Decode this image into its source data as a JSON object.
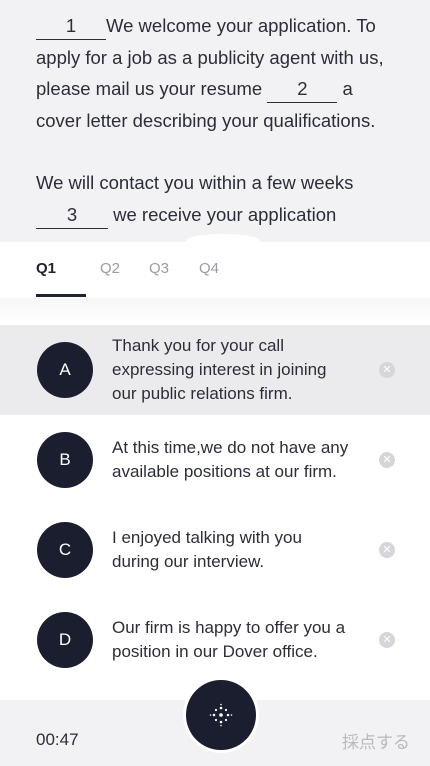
{
  "passage": {
    "blank1": "1",
    "line1_rest": "We welcome your application. To apply for a job as a publicity agent with us, please mail us your resume",
    "blank2": "2",
    "line2_rest": "a cover letter describing your qualifications.",
    "line3_start": "We will contact you within a few weeks",
    "blank3": "3",
    "line3_rest": "we receive your application"
  },
  "tabs": [
    {
      "label": "Q1",
      "active": true
    },
    {
      "label": "Q2",
      "active": false
    },
    {
      "label": "Q3",
      "active": false
    },
    {
      "label": "Q4",
      "active": false
    }
  ],
  "options": [
    {
      "letter": "A",
      "text": "Thank you for your call expressing interest in joining our public relations firm.",
      "selected": true
    },
    {
      "letter": "B",
      "text": "At this time,we do not have any available positions at our firm.",
      "selected": false
    },
    {
      "letter": "C",
      "text": "I enjoyed talking with you during our interview.",
      "selected": false
    },
    {
      "letter": "D",
      "text": "Our firm is happy to offer you a position in our Dover office.",
      "selected": false
    }
  ],
  "footer": {
    "timer": "00:47",
    "score_label": "採点する",
    "center_icon": "sparkle-icon"
  },
  "colors": {
    "accent_dark": "#1b1e2e",
    "selected_bg": "#ebebed",
    "panel_bg": "#f2f2f4"
  }
}
